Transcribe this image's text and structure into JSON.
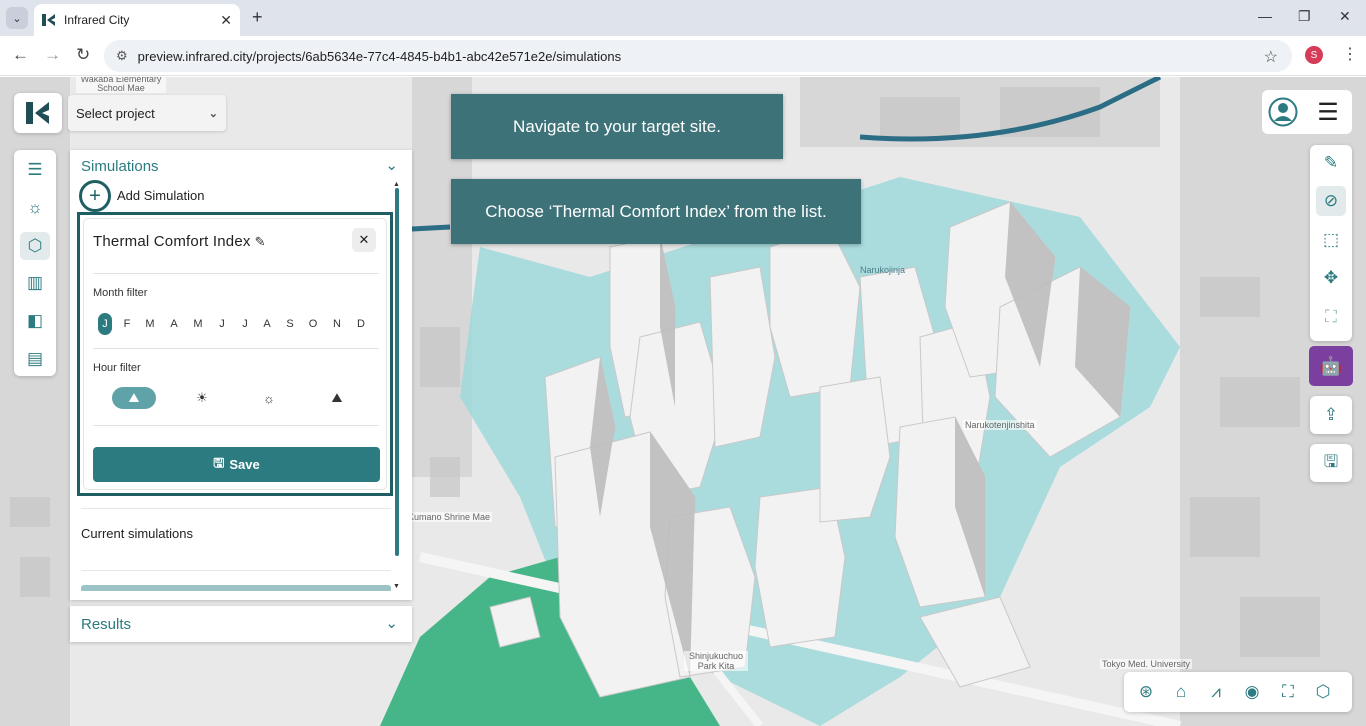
{
  "browser": {
    "tab_title": "Infrared City",
    "url": "preview.infrared.city/projects/6ab5634e-77c4-4845-b4b1-abc42e571e2e/simulations",
    "profile_initial": "S"
  },
  "header": {
    "project_select": "Select project"
  },
  "map_labels": {
    "school": "Wakaba Elementary School Mae",
    "shrine": "Kumano Shrine Mae",
    "narukotenjinshita": "Narukotenjinshita",
    "narukojinja": "Narukojinja",
    "park": "Shinjukuchuo Park Kita",
    "university": "Tokyo Med. University"
  },
  "hints": {
    "step1": "Navigate to your target site.",
    "step2": "Choose ‘Thermal Comfort Index’ from the list."
  },
  "simulations": {
    "title": "Simulations",
    "add_label": "Add Simulation",
    "form": {
      "title": "Thermal Comfort Index",
      "month_filter_label": "Month filter",
      "months": [
        "J",
        "F",
        "M",
        "A",
        "M",
        "J",
        "J",
        "A",
        "S",
        "O",
        "N",
        "D"
      ],
      "selected_month_index": 0,
      "hour_filter_label": "Hour filter",
      "hours": [
        "sunrise-icon",
        "sun-high-icon",
        "sun-low-icon",
        "sunset-icon"
      ],
      "selected_hour_index": 0,
      "save_label": "Save"
    },
    "current_label": "Current simulations"
  },
  "results": {
    "title": "Results"
  },
  "colors": {
    "accent": "#2b7b80",
    "hint_bg": "#3d7278",
    "park": "#46b587",
    "zone": "#9fd8da",
    "bot": "#7b3fa0"
  }
}
